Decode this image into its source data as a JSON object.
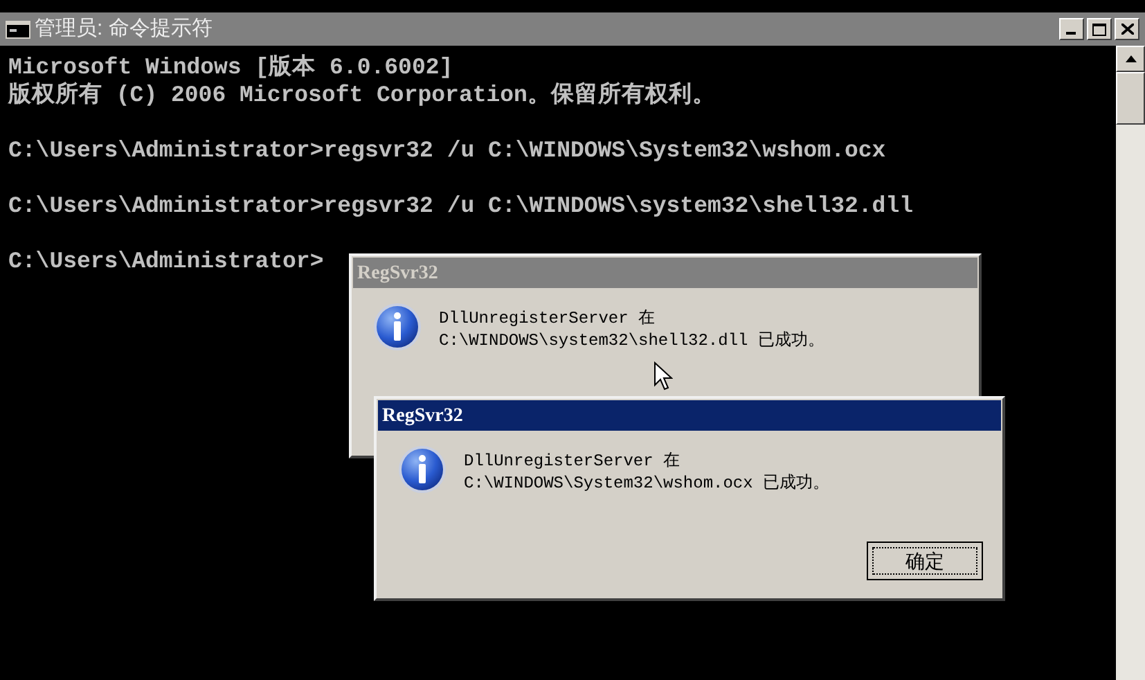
{
  "console": {
    "title": "管理员: 命令提示符",
    "active": false,
    "blocks": [
      [
        "Microsoft Windows [版本 6.0.6002]",
        "版权所有 (C) 2006 Microsoft Corporation。保留所有权利。"
      ],
      [
        "C:\\Users\\Administrator>regsvr32 /u C:\\WINDOWS\\System32\\wshom.ocx"
      ],
      [
        "C:\\Users\\Administrator>regsvr32 /u C:\\WINDOWS\\system32\\shell32.dll"
      ],
      [
        "C:\\Users\\Administrator>"
      ]
    ]
  },
  "dialogs": [
    {
      "title": "RegSvr32",
      "active": false,
      "message": [
        "DllUnregisterServer 在",
        "C:\\WINDOWS\\system32\\shell32.dll 已成功。"
      ]
    },
    {
      "title": "RegSvr32",
      "active": true,
      "message": [
        "DllUnregisterServer 在",
        "C:\\WINDOWS\\System32\\wshom.ocx 已成功。"
      ],
      "button": "确定"
    }
  ]
}
